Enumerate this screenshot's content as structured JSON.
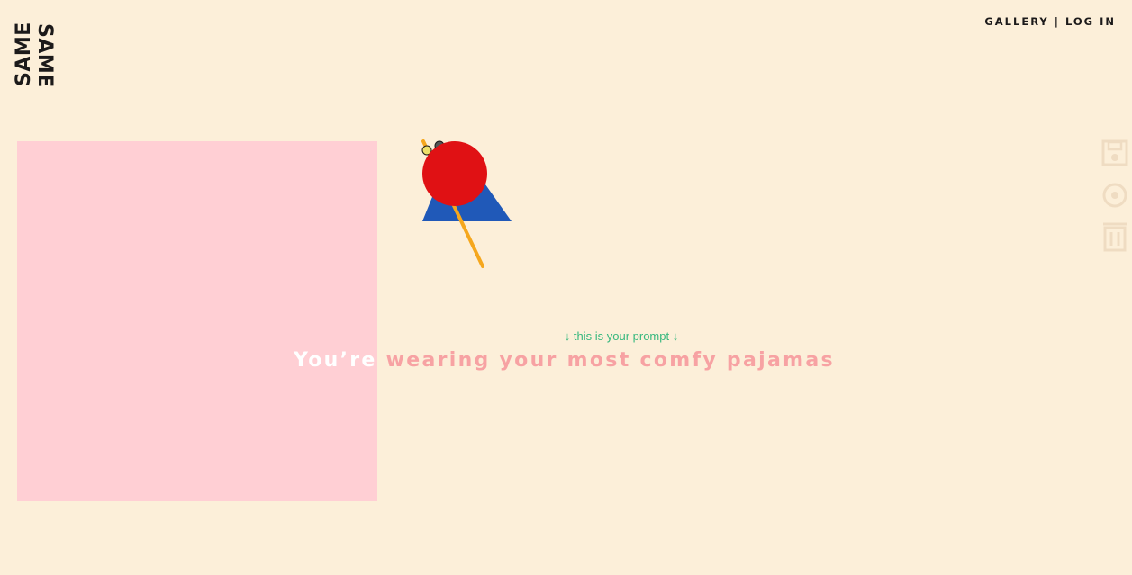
{
  "logo": {
    "word_top": "SAME",
    "word_bottom": "SAME"
  },
  "nav": {
    "gallery": "GALLERY",
    "separator": "|",
    "login": "LOG IN"
  },
  "prompt_hint": {
    "arrow_left": "↓",
    "text": "this is your prompt",
    "arrow_right": "↓"
  },
  "prompt": {
    "first_word": "You’re",
    "rest": "wearing your most comfy pajamas"
  },
  "tools": [
    {
      "name": "save-icon"
    },
    {
      "name": "circle-tool-icon"
    },
    {
      "name": "trash-icon"
    }
  ],
  "colors": {
    "background": "#fcefd9",
    "canvas": "#ffcfd4",
    "prompt": "#f7a2a3",
    "prompt_highlight": "#ffffff",
    "hint": "#37b87e",
    "shape_circle": "#e01114",
    "shape_triangle": "#2059b8",
    "shape_line": "#f5a71d",
    "tool_icons": "#efdcc2"
  }
}
